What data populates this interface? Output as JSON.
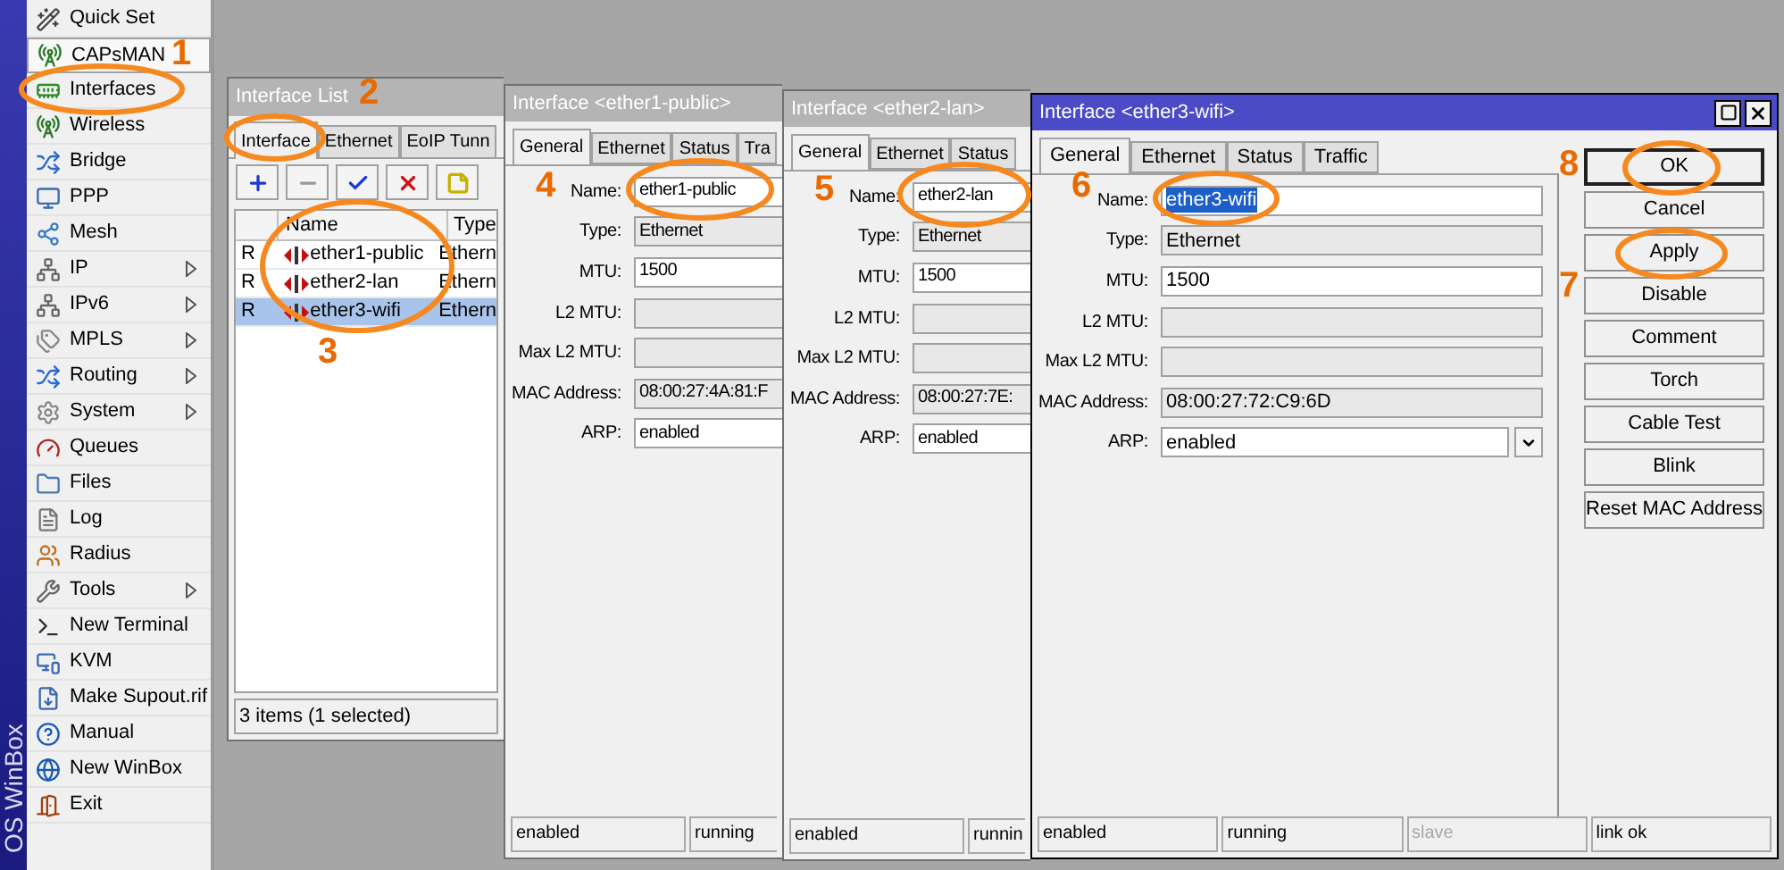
{
  "sidebar": {
    "brand": "OS WinBox",
    "items": [
      {
        "label": "Quick Set",
        "submenu": false,
        "hovered": false
      },
      {
        "label": "CAPsMAN",
        "submenu": false,
        "hovered": true
      },
      {
        "label": "Interfaces",
        "submenu": false,
        "hovered": false
      },
      {
        "label": "Wireless",
        "submenu": false,
        "hovered": false
      },
      {
        "label": "Bridge",
        "submenu": false,
        "hovered": false
      },
      {
        "label": "PPP",
        "submenu": false,
        "hovered": false
      },
      {
        "label": "Mesh",
        "submenu": false,
        "hovered": false
      },
      {
        "label": "IP",
        "submenu": true,
        "hovered": false
      },
      {
        "label": "IPv6",
        "submenu": true,
        "hovered": false
      },
      {
        "label": "MPLS",
        "submenu": true,
        "hovered": false
      },
      {
        "label": "Routing",
        "submenu": true,
        "hovered": false
      },
      {
        "label": "System",
        "submenu": true,
        "hovered": false
      },
      {
        "label": "Queues",
        "submenu": false,
        "hovered": false
      },
      {
        "label": "Files",
        "submenu": false,
        "hovered": false
      },
      {
        "label": "Log",
        "submenu": false,
        "hovered": false
      },
      {
        "label": "Radius",
        "submenu": false,
        "hovered": false
      },
      {
        "label": "Tools",
        "submenu": true,
        "hovered": false
      },
      {
        "label": "New Terminal",
        "submenu": false,
        "hovered": false
      },
      {
        "label": "KVM",
        "submenu": false,
        "hovered": false
      },
      {
        "label": "Make Supout.rif",
        "submenu": false,
        "hovered": false
      },
      {
        "label": "Manual",
        "submenu": false,
        "hovered": false
      },
      {
        "label": "New WinBox",
        "submenu": false,
        "hovered": false
      },
      {
        "label": "Exit",
        "submenu": false,
        "hovered": false
      }
    ]
  },
  "interface_list": {
    "title": "Interface List",
    "tabs": [
      {
        "label": "Interface",
        "selected": true
      },
      {
        "label": "Ethernet",
        "selected": false
      },
      {
        "label": "EoIP Tunn",
        "selected": false
      }
    ],
    "columns": [
      "Name",
      "Type"
    ],
    "rows": [
      {
        "flag": "R",
        "name": "ether1-public",
        "type": "Ethern",
        "selected": false
      },
      {
        "flag": "R",
        "name": "ether2-lan",
        "type": "Ethern",
        "selected": false
      },
      {
        "flag": "R",
        "name": "ether3-wifi",
        "type": "Ethern",
        "selected": true
      }
    ],
    "status": "3 items (1 selected)"
  },
  "interface_windows": [
    {
      "title": "Interface <ether1-public>",
      "active": false,
      "tabs": [
        {
          "label": "General",
          "selected": true
        },
        {
          "label": "Ethernet",
          "selected": false
        },
        {
          "label": "Status",
          "selected": false
        },
        {
          "label": "Tra",
          "selected": false
        }
      ],
      "fields": [
        {
          "label": "Name:",
          "value": "ether1-public",
          "kind": "input",
          "highlighted": false
        },
        {
          "label": "Type:",
          "value": "Ethernet",
          "kind": "readonly",
          "highlighted": false
        },
        {
          "label": "MTU:",
          "value": "1500",
          "kind": "input",
          "highlighted": false
        },
        {
          "label": "L2 MTU:",
          "kind": "readonly"
        },
        {
          "label": "Max L2 MTU:",
          "kind": "readonly"
        },
        {
          "label": "MAC Address:",
          "value": "08:00:27:4A:81:F",
          "kind": "readonly",
          "highlighted": false
        },
        {
          "label": "ARP:",
          "value": "enabled",
          "kind": "input",
          "highlighted": false
        }
      ],
      "status_bar": [
        {
          "text": "enabled",
          "disabled": false
        },
        {
          "text": "running",
          "disabled": false
        }
      ]
    },
    {
      "title": "Interface <ether2-lan>",
      "active": false,
      "tabs": [
        {
          "label": "General",
          "selected": true
        },
        {
          "label": "Ethernet",
          "selected": false
        },
        {
          "label": "Status",
          "selected": false
        }
      ],
      "fields": [
        {
          "label": "Name:",
          "value": "ether2-lan",
          "kind": "input",
          "highlighted": false
        },
        {
          "label": "Type:",
          "value": "Ethernet",
          "kind": "readonly",
          "highlighted": false
        },
        {
          "label": "MTU:",
          "value": "1500",
          "kind": "input",
          "highlighted": false
        },
        {
          "label": "L2 MTU:",
          "kind": "readonly"
        },
        {
          "label": "Max L2 MTU:",
          "kind": "readonly"
        },
        {
          "label": "MAC Address:",
          "value": "08:00:27:7E:",
          "kind": "readonly",
          "highlighted": false
        },
        {
          "label": "ARP:",
          "value": "enabled",
          "kind": "input",
          "highlighted": false
        }
      ],
      "status_bar": [
        {
          "text": "enabled",
          "disabled": false
        },
        {
          "text": "runnin",
          "disabled": false
        }
      ]
    },
    {
      "title": "Interface <ether3-wifi>",
      "active": true,
      "tabs": [
        {
          "label": "General",
          "selected": true
        },
        {
          "label": "Ethernet",
          "selected": false
        },
        {
          "label": "Status",
          "selected": false
        },
        {
          "label": "Traffic",
          "selected": false
        }
      ],
      "fields": [
        {
          "label": "Name:",
          "value": "ether3-wifi",
          "kind": "input",
          "highlighted": true
        },
        {
          "label": "Type:",
          "value": "Ethernet",
          "kind": "readonly",
          "highlighted": false
        },
        {
          "label": "MTU:",
          "value": "1500",
          "kind": "input",
          "highlighted": false
        },
        {
          "label": "L2 MTU:",
          "kind": "readonly"
        },
        {
          "label": "Max L2 MTU:",
          "kind": "readonly"
        },
        {
          "label": "MAC Address:",
          "value": "08:00:27:72:C9:6D",
          "kind": "readonly",
          "highlighted": false
        },
        {
          "label": "ARP:",
          "value": "enabled",
          "kind": "dropdown",
          "highlighted": false
        }
      ],
      "buttons": [
        {
          "label": "OK",
          "default": true
        },
        {
          "label": "Cancel",
          "default": false
        },
        {
          "label": "Apply",
          "default": false
        },
        {
          "label": "Disable",
          "default": false
        },
        {
          "label": "Comment",
          "default": false
        },
        {
          "label": "Torch",
          "default": false
        },
        {
          "label": "Cable Test",
          "default": false
        },
        {
          "label": "Blink",
          "default": false
        },
        {
          "label": "Reset MAC Address",
          "default": false
        }
      ],
      "status_bar": [
        {
          "text": "enabled",
          "disabled": false
        },
        {
          "text": "running",
          "disabled": false
        },
        {
          "text": "slave",
          "disabled": true
        },
        {
          "text": "link ok",
          "disabled": false
        }
      ]
    }
  ],
  "annotations": [
    {
      "label": "1"
    },
    {
      "label": "2"
    },
    {
      "label": "3"
    },
    {
      "label": "4"
    },
    {
      "label": "5"
    },
    {
      "label": "6"
    },
    {
      "label": "7"
    },
    {
      "label": "8"
    }
  ]
}
